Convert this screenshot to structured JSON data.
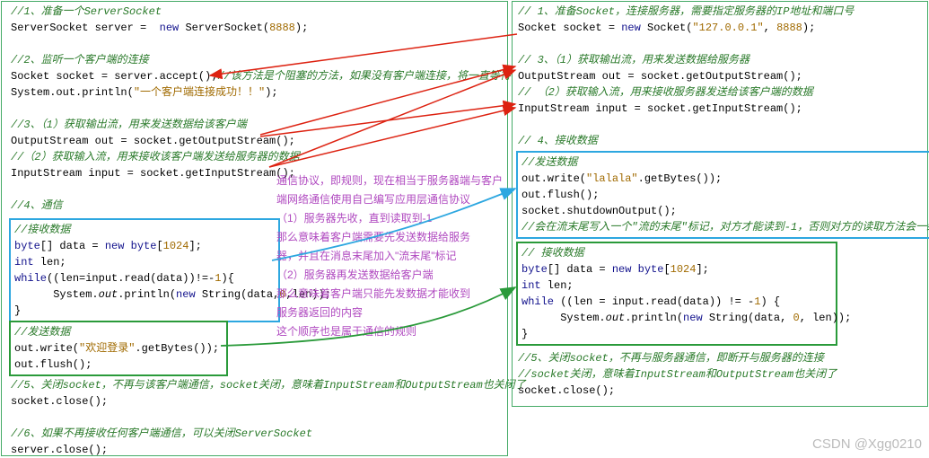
{
  "left": {
    "c1": "//1、准备一个ServerSocket",
    "l1a": "ServerSocket server = ",
    "l1b": " new",
    "l1c": " ServerSocket(",
    "l1num": "8888",
    "l1d": ");",
    "c2": "//2、监听一个客户端的连接",
    "l2": "Socket socket = server.accept();",
    "l2cmt": "//该方法是个阻塞的方法，如果没有客户端连接，将一直等待",
    "l2p": "System.out.println(",
    "l2pstr": "\"一个客户端连接成功！！\"",
    "l2pend": ");",
    "c3a": "//3、（1）获取输出流，用来发送数据给该客户端",
    "l3": "OutputStream out = socket.getOutputStream();",
    "c3b": "//（2）获取输入流，用来接收该客户端发送给服务器的数据",
    "l3b": "InputStream input = socket.getInputStream();",
    "c4": "//4、通信",
    "recv_cmt": "//接收数据",
    "recv_l1a": "byte",
    "recv_l1b": "[] data = ",
    "recv_l1c": "new byte",
    "recv_l1d": "[",
    "recv_l1num": "1024",
    "recv_l1e": "];",
    "recv_l2a": "int",
    "recv_l2b": " len;",
    "recv_l3a": "while",
    "recv_l3b": "((len=input.read(data))!=-",
    "recv_l3num": "1",
    "recv_l3c": "){",
    "recv_l4a": "      System.",
    "recv_l4b": "out",
    "recv_l4c": ".println(",
    "recv_l4d": "new",
    "recv_l4e": " String(data,",
    "recv_l4n1": "0",
    "recv_l4f": ",len));",
    "recv_l5": "}",
    "send_cmt": "//发送数据",
    "send_l1": "out.write(",
    "send_str": "\"欢迎登录\"",
    "send_l1b": ".getBytes());",
    "send_l2": "out.flush();",
    "c5": "//5、关闭socket，不再与该客户端通信，socket关闭，意味着InputStream和OutputStream也关闭了",
    "l5": "socket.close();",
    "c6": "//6、如果不再接收任何客户端通信，可以关闭ServerSocket",
    "l6": "server.close();"
  },
  "right": {
    "c1": "// 1、准备Socket，连接服务器，需要指定服务器的IP地址和端口号",
    "l1a": "Socket socket = ",
    "l1b": "new",
    "l1c": " Socket(",
    "l1s": "\"127.0.0.1\"",
    "l1d": ", ",
    "l1n": "8888",
    "l1e": ");",
    "c3a": "// 3、（1）获取输出流，用来发送数据给服务器",
    "l3": "OutputStream out = socket.getOutputStream();",
    "c3b": "// （2）获取输入流，用来接收服务器发送给该客户端的数据",
    "l3b": "InputStream input = socket.getInputStream();",
    "c4": "// 4、接收数据",
    "send_cmt": "//发送数据",
    "send_l1": "out.write(",
    "send_str": "\"lalala\"",
    "send_l1b": ".getBytes());",
    "send_l2": "out.flush();",
    "send_l3": "socket.shutdownOutput();",
    "send_cmt2": "//会在流末尾写入一个\"流的末尾\"标记，对方才能读到-1，否则对方的读取方法会一致阻塞",
    "recv_cmt": "// 接收数据",
    "recv_l1a": "byte",
    "recv_l1b": "[] data = ",
    "recv_l1c": "new byte",
    "recv_l1d": "[",
    "recv_l1num": "1024",
    "recv_l1e": "];",
    "recv_l2a": "int",
    "recv_l2b": " len;",
    "recv_l3a": "while",
    "recv_l3b": " ((len = input.read(data)) != -",
    "recv_l3num": "1",
    "recv_l3c": ") {",
    "recv_l4a": "      System.",
    "recv_l4b": "out",
    "recv_l4c": ".println(",
    "recv_l4d": "new",
    "recv_l4e": " String(data, ",
    "recv_l4n1": "0",
    "recv_l4f": ", len));",
    "recv_l5": "}",
    "c5": "//5、关闭socket，不再与服务器通信，即断开与服务器的连接",
    "c5b": "//socket关闭，意味着InputStream和OutputStream也关闭了",
    "l5": "socket.close();"
  },
  "annot": {
    "a1": "通信协议，即规则，现在相当于服务器端与客户",
    "a2": "端网络通信使用自己编写应用层通信协议",
    "a3": "（1）服务器先收，直到读取到-1",
    "a4": "      那么意味着客户端需要先发送数据给服务",
    "a5": "器，并且在消息末尾加入\"流末尾\"标记",
    "a6": "（2）服务器再发送数据给客户端",
    "a7": "      那么意味着客户端只能先发数据才能收到",
    "a8": "服务器返回的内容",
    "a9": "这个顺序也是属于通信的规则"
  },
  "watermark": "CSDN @Xgg0210"
}
